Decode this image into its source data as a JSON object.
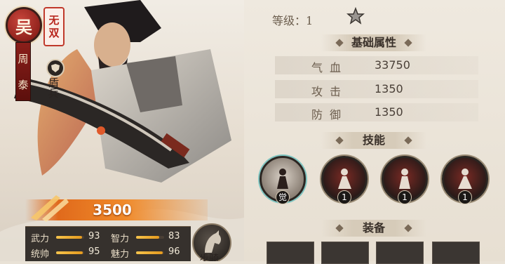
{
  "hero": {
    "faction": "吴",
    "name": [
      "周",
      "泰"
    ],
    "title": [
      "无",
      "双"
    ],
    "troop_type": "盾兵",
    "power": "3500",
    "stats": [
      {
        "label": "武力",
        "value": "93",
        "fill": 0.93
      },
      {
        "label": "智力",
        "value": "83",
        "fill": 0.83
      },
      {
        "label": "统帅",
        "value": "95",
        "fill": 0.95
      },
      {
        "label": "魅力",
        "value": "96",
        "fill": 0.96
      }
    ],
    "cavalry_label": "步骑"
  },
  "detail": {
    "level_label": "等级：1",
    "basic_header": "基础属性",
    "attributes": [
      {
        "label": "气血",
        "value": "33750"
      },
      {
        "label": "攻击",
        "value": "1350"
      },
      {
        "label": "防御",
        "value": "1350"
      }
    ],
    "skill_header": "技能",
    "skills": [
      {
        "level": "觉",
        "icon": "skill-awaken-icon"
      },
      {
        "level": "1",
        "icon": "skill-fire-icon"
      },
      {
        "level": "1",
        "icon": "skill-warrior-icon"
      },
      {
        "level": "1",
        "icon": "skill-blade-icon"
      }
    ],
    "equip_header": "装备"
  },
  "colors": {
    "faction_red": "#8a1f1a",
    "power_orange": "#f08a2a",
    "panel_bg": "#efe9df",
    "skill_ring_highlight": "#7ec4c0"
  }
}
